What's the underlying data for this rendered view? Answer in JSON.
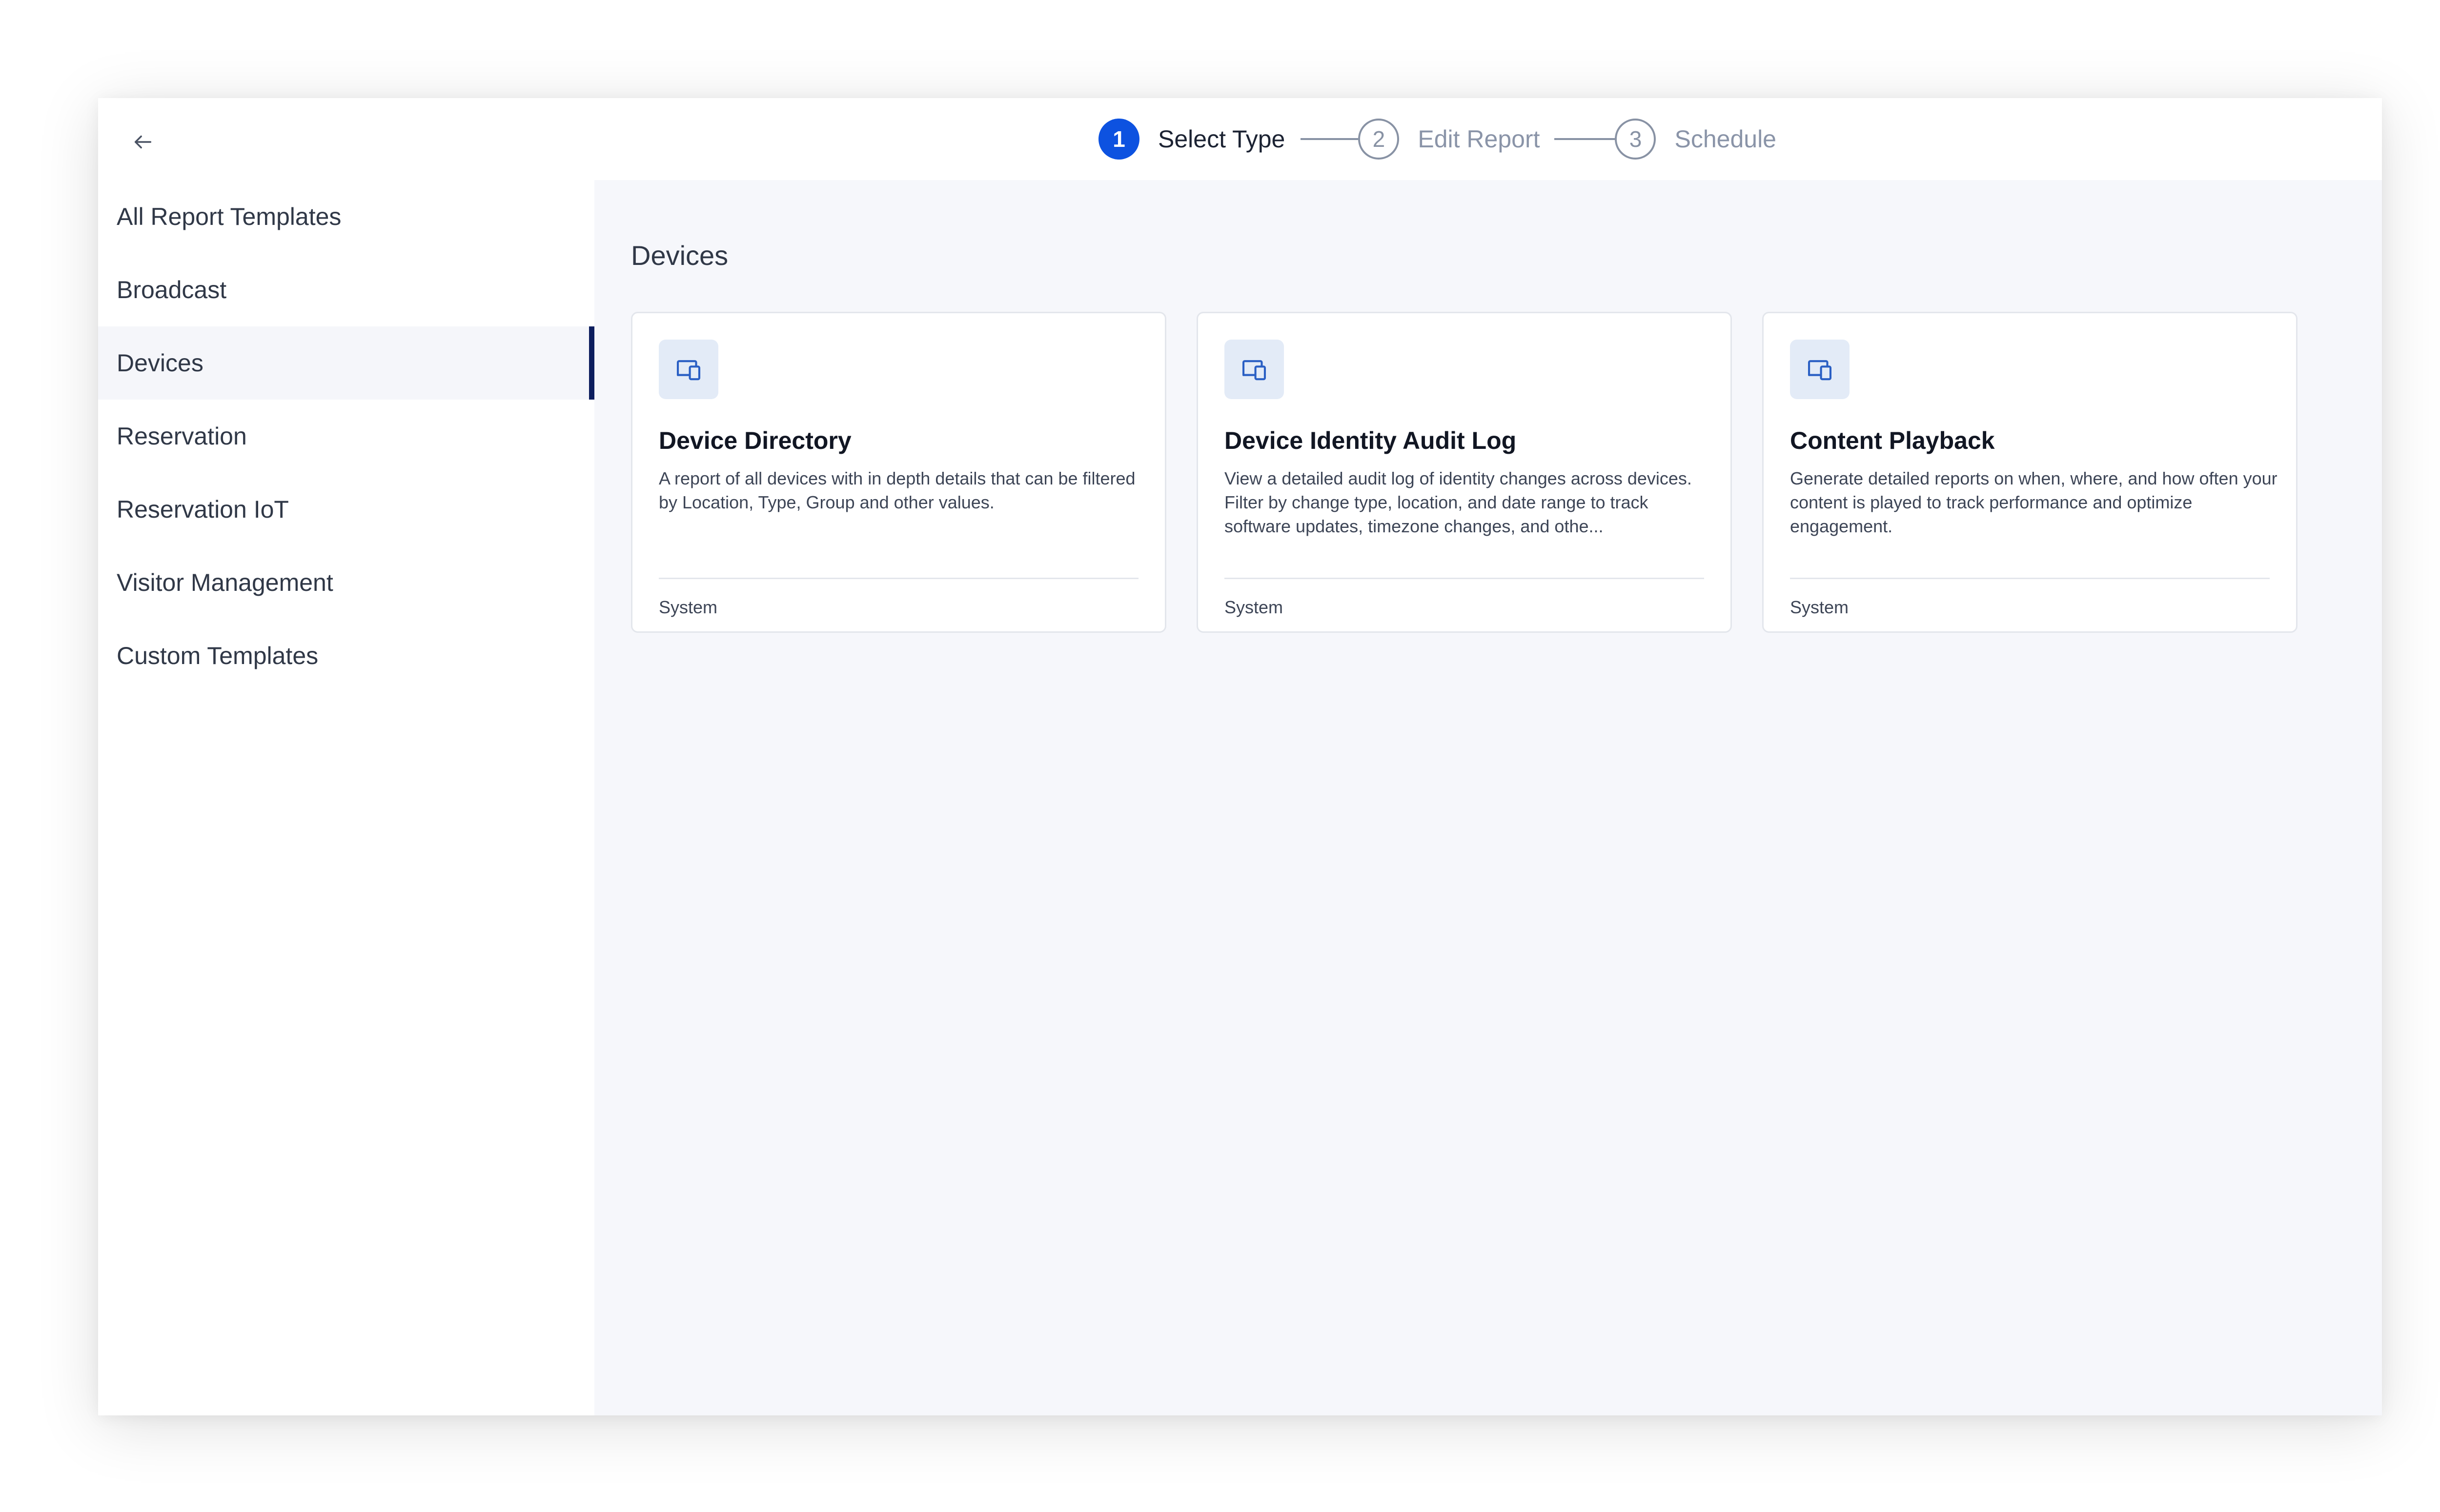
{
  "stepper": {
    "steps": [
      {
        "number": "1",
        "label": "Select Type",
        "state": "active"
      },
      {
        "number": "2",
        "label": "Edit Report",
        "state": "inactive"
      },
      {
        "number": "3",
        "label": "Schedule",
        "state": "inactive"
      }
    ]
  },
  "sidebar": {
    "items": [
      {
        "label": "All Report Templates"
      },
      {
        "label": "Broadcast"
      },
      {
        "label": "Devices",
        "selected": true
      },
      {
        "label": "Reservation"
      },
      {
        "label": "Reservation IoT"
      },
      {
        "label": "Visitor Management"
      },
      {
        "label": "Custom Templates"
      }
    ]
  },
  "main": {
    "section_title": "Devices",
    "cards": [
      {
        "icon": "devices-icon",
        "title": "Device Directory",
        "description": "A report of all devices with in depth details that can be filtered by Location, Type, Group and other values.",
        "footer": "System"
      },
      {
        "icon": "devices-icon",
        "title": "Device Identity Audit Log",
        "description": "View a detailed audit log of identity changes across devices. Filter by change type, location, and date range to track software updates, timezone changes, and othe...",
        "footer": "System"
      },
      {
        "icon": "devices-icon",
        "title": "Content Playback",
        "description": "Generate detailed reports on when, where, and how often your content is played to track performance and optimize engagement.",
        "footer": "System"
      }
    ]
  },
  "colors": {
    "accent": "#0d52e0",
    "selected_indicator": "#0d1e5e",
    "icon_tile_bg": "#e3ebf7",
    "main_bg": "#f6f7fb"
  }
}
